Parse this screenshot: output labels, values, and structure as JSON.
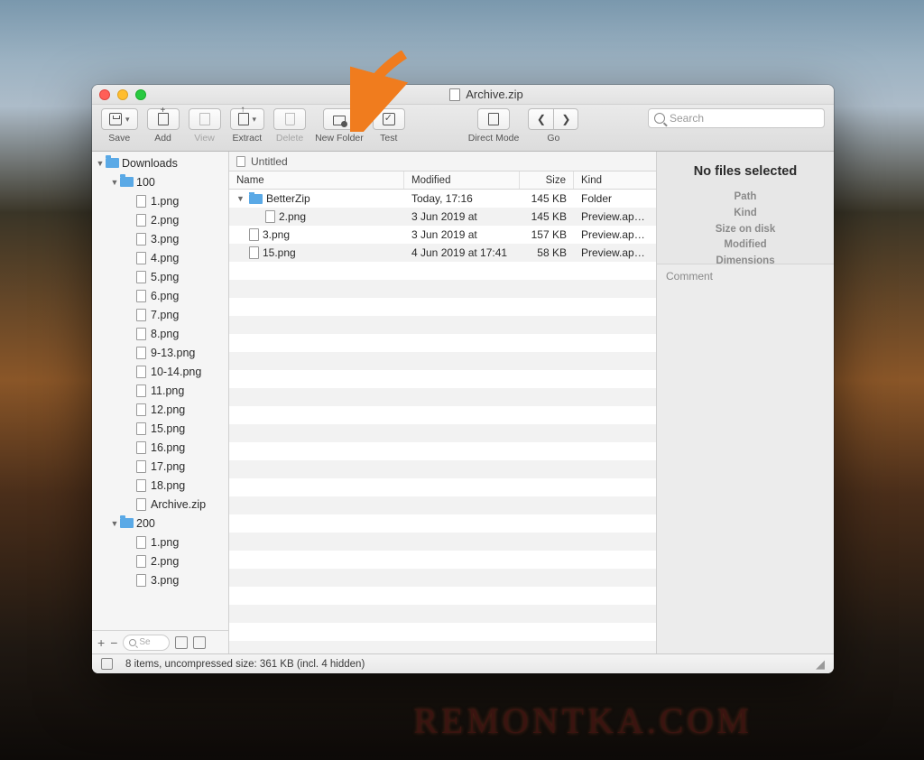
{
  "window": {
    "title": "Archive.zip"
  },
  "toolbar": {
    "save": "Save",
    "add": "Add",
    "view": "View",
    "extract": "Extract",
    "delete": "Delete",
    "new_folder": "New Folder",
    "test": "Test",
    "direct_mode": "Direct Mode",
    "go": "Go",
    "search_placeholder": "Search"
  },
  "sidebar": {
    "root": "Downloads",
    "folders": [
      {
        "name": "100",
        "files": [
          "1.png",
          "2.png",
          "3.png",
          "4.png",
          "5.png",
          "6.png",
          "7.png",
          "8.png",
          "9-13.png",
          "10-14.png",
          "11.png",
          "12.png",
          "15.png",
          "16.png",
          "17.png",
          "18.png",
          "Archive.zip"
        ]
      },
      {
        "name": "200",
        "files": [
          "1.png",
          "2.png",
          "3.png"
        ]
      }
    ],
    "bottom_search_placeholder": "Se"
  },
  "pathbar": {
    "label": "Untitled"
  },
  "columns": {
    "name": "Name",
    "modified": "Modified",
    "size": "Size",
    "kind": "Kind"
  },
  "rows": [
    {
      "indent": 0,
      "twist": "▼",
      "icon": "folder",
      "name": "BetterZip",
      "modified": "Today, 17:16",
      "size": "145 KB",
      "kind": "Folder"
    },
    {
      "indent": 1,
      "twist": "",
      "icon": "file",
      "name": "2.png",
      "modified": "3 Jun 2019 at",
      "size": "145 KB",
      "kind": "Preview.app Doc"
    },
    {
      "indent": 0,
      "twist": "",
      "icon": "file",
      "name": "3.png",
      "modified": "3 Jun 2019 at",
      "size": "157 KB",
      "kind": "Preview.app Doc"
    },
    {
      "indent": 0,
      "twist": "",
      "icon": "file",
      "name": "15.png",
      "modified": "4 Jun 2019 at 17:41",
      "size": "58 KB",
      "kind": "Preview.app Doc"
    }
  ],
  "inspector": {
    "title": "No files selected",
    "path": "Path",
    "kind": "Kind",
    "size_on_disk": "Size on disk",
    "modified": "Modified",
    "dimensions": "Dimensions",
    "comment_label": "Comment"
  },
  "statusbar": {
    "text": "8 items, uncompressed size: 361 KB (incl. 4 hidden)"
  },
  "watermark": "REMONTKA.COM"
}
